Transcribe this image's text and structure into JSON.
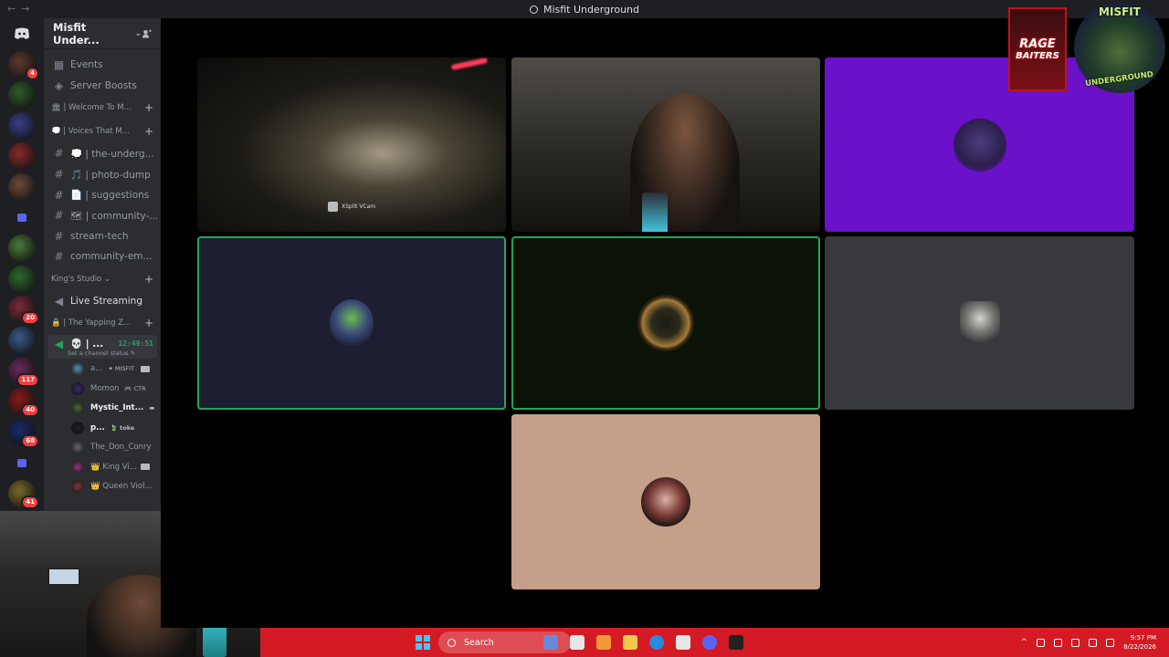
{
  "window": {
    "title": "Misfit Underground",
    "nav_back": "←",
    "nav_fwd": "→"
  },
  "guilds": [
    {
      "name": "home",
      "icon": "discord-icon"
    },
    {
      "name": "server-1",
      "color": "#5c3a2e",
      "badge": "4"
    },
    {
      "name": "server-2",
      "color": "#2f5a2a",
      "badge": ""
    },
    {
      "name": "server-3",
      "color": "#3a3f8a",
      "badge": ""
    },
    {
      "name": "server-4",
      "color": "#8a2a2a",
      "badge": ""
    },
    {
      "name": "server-5",
      "color": "#6b4a3a",
      "badge": ""
    },
    {
      "name": "folder-1",
      "folder": true
    },
    {
      "name": "server-6",
      "color": "#4a7a3a",
      "badge": ""
    },
    {
      "name": "server-7",
      "color": "#2e6a2e",
      "badge": ""
    },
    {
      "name": "server-8",
      "color": "#7a2a3a",
      "badge": "20"
    },
    {
      "name": "server-9",
      "color": "#3a5a8a",
      "badge": ""
    },
    {
      "name": "server-10",
      "color": "#6a2a5a",
      "badge": "117"
    },
    {
      "name": "server-11",
      "color": "#8a1a1a",
      "badge": "40"
    },
    {
      "name": "server-12",
      "color": "#1a2a6a",
      "badge": "68"
    },
    {
      "name": "folder-2",
      "folder": true
    },
    {
      "name": "server-13",
      "color": "#7a6a2a",
      "badge": "41"
    }
  ],
  "server": {
    "name": "Misfit Under...",
    "chevron": "⌄"
  },
  "channels": {
    "top": [
      {
        "icon": "calendar-icon",
        "glyph": "▦",
        "label": "Events"
      },
      {
        "icon": "boost-icon",
        "glyph": "◈",
        "label": "Server Boosts"
      }
    ],
    "cat1": {
      "label": "🏛 | Welcome To M...",
      "plus": "+"
    },
    "cat2": {
      "label": "💭 | Voices That M...",
      "plus": "+"
    },
    "text": [
      {
        "label": "💭 | the-underg..."
      },
      {
        "label": "🎵 | photo-dump"
      },
      {
        "label": "📄 | suggestions"
      },
      {
        "label": "🗺 | community-..."
      },
      {
        "label": "stream-tech"
      },
      {
        "label": "community-em..."
      }
    ],
    "cat3": {
      "label": "King's Studio ⌄",
      "plus": "+"
    },
    "live": {
      "label": "Live Streaming"
    },
    "cat4": {
      "label": "🔒 | The Yapping Z...",
      "plus": "+"
    },
    "vc": {
      "label": "💀 | ...",
      "time": "12:49:51",
      "status": "Set a channel status ✎"
    },
    "users": [
      {
        "name": "a...",
        "extra": "✦ MISFIT",
        "color": "#5f8fa8",
        "cam": true,
        "bright": false
      },
      {
        "name": "Momon",
        "extra": "🎮 CTR",
        "color": "#3a2a6a",
        "cam": false,
        "bright": false
      },
      {
        "name": "Mystic_Int...",
        "extra": "▬",
        "color": "#4a6a3a",
        "cam": false,
        "bright": true
      },
      {
        "name": "p...",
        "extra": "🍃 toke",
        "color": "#1e1f22",
        "cam": false,
        "bright": true
      },
      {
        "name": "The_Don_Conry",
        "extra": "",
        "color": "#6a6a6a",
        "cam": false,
        "bright": false
      },
      {
        "name": "👑 King Vi...",
        "extra": "",
        "color": "#8a3a7a",
        "cam": true,
        "bright": false
      },
      {
        "name": "👑 Queen Viol...",
        "extra": "",
        "color": "#7a3a3a",
        "cam": false,
        "bright": false
      }
    ]
  },
  "stage": {
    "tile1_label": "XSplit VCam",
    "overlay_rage": {
      "line1": "RAGE",
      "line2": "BAITERS"
    },
    "overlay_misfit": {
      "top": "MISFIT",
      "bottom": "UNDERGROUND"
    }
  },
  "taskbar": {
    "search_placeholder": "Search",
    "apps": [
      {
        "name": "widgets",
        "color": "#6a8ad8"
      },
      {
        "name": "task-view",
        "color": "#e6e6e6"
      },
      {
        "name": "copilot",
        "color": "#f09a3a"
      },
      {
        "name": "file-explorer",
        "color": "#f2c94c"
      },
      {
        "name": "chrome",
        "color": "#2a8adf"
      },
      {
        "name": "store",
        "color": "#e6e6e6"
      },
      {
        "name": "discord",
        "color": "#5865f2"
      },
      {
        "name": "obs",
        "color": "#222"
      }
    ],
    "time": "9:57 PM",
    "date": "8/22/2026"
  }
}
